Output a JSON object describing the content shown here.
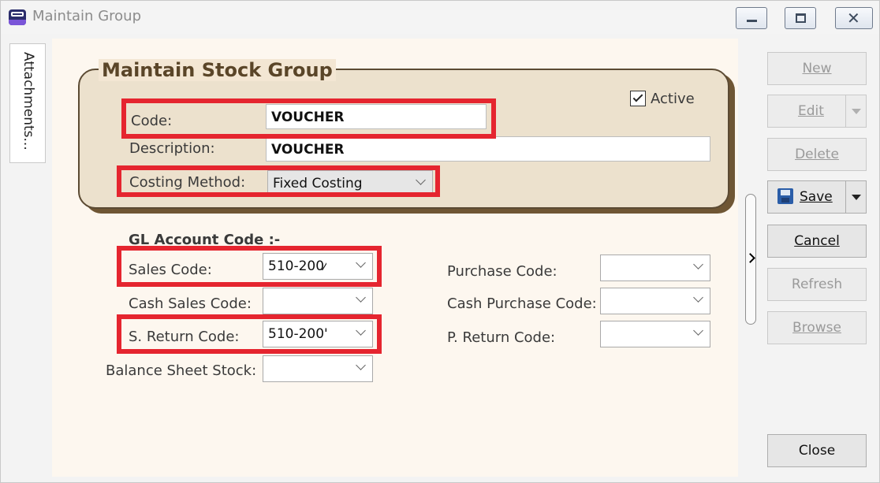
{
  "window": {
    "title": "Maintain Group"
  },
  "sidetab": {
    "label": "Attachments..."
  },
  "group": {
    "title": "Maintain Stock Group",
    "active_label": "Active",
    "active_checked": true,
    "code_label": "Code:",
    "code_value": "VOUCHER",
    "description_label": "Description:",
    "description_value": "VOUCHER",
    "costing_label": "Costing Method:",
    "costing_value": "Fixed Costing"
  },
  "gl": {
    "heading": "GL Account Code :-",
    "sales_label": "Sales Code:",
    "sales_value": "510-200⁄",
    "cash_sales_label": "Cash Sales Code:",
    "cash_sales_value": "",
    "sreturn_label": "S. Return Code:",
    "sreturn_value": "510-200'",
    "balance_label": "Balance Sheet Stock:",
    "balance_value": "",
    "purchase_label": "Purchase Code:",
    "purchase_value": "",
    "cash_purchase_label": "Cash Purchase Code:",
    "cash_purchase_value": "",
    "preturn_label": "P. Return Code:",
    "preturn_value": ""
  },
  "buttons": {
    "new": "New",
    "edit": "Edit",
    "delete": "Delete",
    "save": "Save",
    "cancel": "Cancel",
    "refresh": "Refresh",
    "browse": "Browse",
    "close": "Close"
  },
  "icons": {
    "minimize": "minimize-icon",
    "maximize": "maximize-icon",
    "close": "close-icon",
    "checkbox": "checkbox-checked-icon",
    "save": "floppy-disk-icon",
    "dropdown": "chevron-down-icon",
    "collapse": "chevron-right-icon"
  },
  "colors": {
    "highlight_box": "#e5252f",
    "group_title": "#5a4528",
    "panel_bg": "#fdf7ef",
    "groupbox_bg": "#ece1cd"
  }
}
